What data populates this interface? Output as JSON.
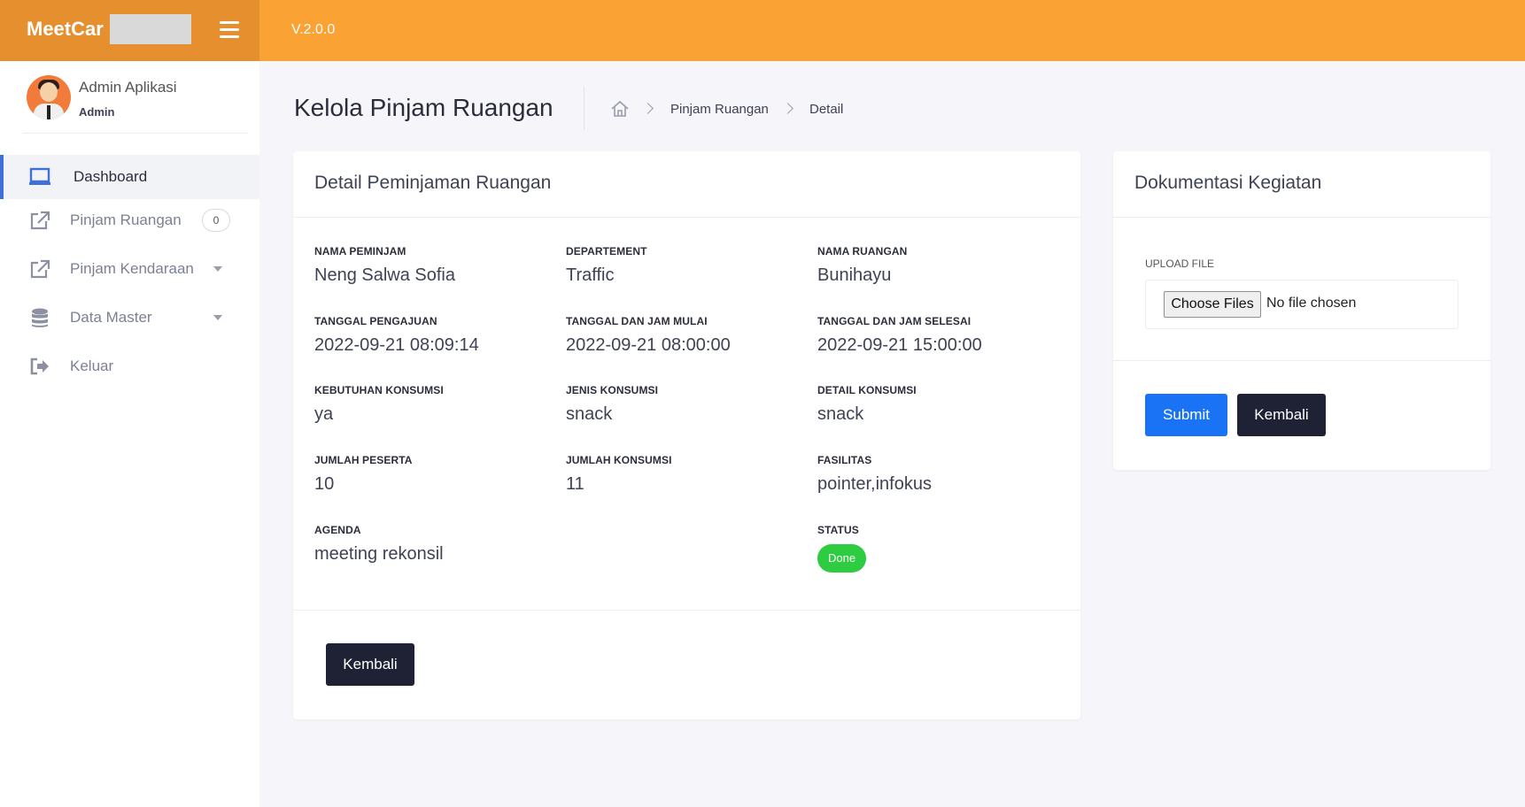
{
  "topbar": {
    "brand": "MeetCar",
    "version": "V.2.0.0"
  },
  "user": {
    "name": "Admin Aplikasi",
    "role": "Admin"
  },
  "sidebar": {
    "items": [
      {
        "label": "Dashboard",
        "icon": "laptop-icon",
        "active": true
      },
      {
        "label": "Pinjam Ruangan",
        "icon": "external-link-icon",
        "badge": "0"
      },
      {
        "label": "Pinjam Kendaraan",
        "icon": "external-link-icon",
        "has_caret": true
      },
      {
        "label": "Data Master",
        "icon": "database-icon",
        "has_caret": true
      },
      {
        "label": "Keluar",
        "icon": "sign-out-icon"
      }
    ]
  },
  "header": {
    "title": "Kelola Pinjam Ruangan",
    "breadcrumb": [
      "Pinjam Ruangan",
      "Detail"
    ]
  },
  "detail": {
    "title": "Detail Peminjaman Ruangan",
    "fields": {
      "nama_peminjam": {
        "label": "NAMA PEMINJAM",
        "value": "Neng Salwa Sofia"
      },
      "departement": {
        "label": "DEPARTEMENT",
        "value": "Traffic"
      },
      "nama_ruangan": {
        "label": "NAMA RUANGAN",
        "value": "Bunihayu"
      },
      "tanggal_pengajuan": {
        "label": "TANGGAL PENGAJUAN",
        "value": "2022-09-21 08:09:14"
      },
      "tanggal_mulai": {
        "label": "TANGGAL DAN JAM MULAI",
        "value": "2022-09-21 08:00:00"
      },
      "tanggal_selesai": {
        "label": "TANGGAL DAN JAM SELESAI",
        "value": "2022-09-21 15:00:00"
      },
      "kebutuhan_konsumsi": {
        "label": "KEBUTUHAN KONSUMSI",
        "value": "ya"
      },
      "jenis_konsumsi": {
        "label": "JENIS KONSUMSI",
        "value": "snack"
      },
      "detail_konsumsi": {
        "label": "DETAIL KONSUMSI",
        "value": "snack"
      },
      "jumlah_peserta": {
        "label": "JUMLAH PESERTA",
        "value": "10"
      },
      "jumlah_konsumsi": {
        "label": "JUMLAH KONSUMSI",
        "value": "11"
      },
      "fasilitas": {
        "label": "FASILITAS",
        "value": "pointer,infokus"
      },
      "agenda": {
        "label": "AGENDA",
        "value": "meeting rekonsil"
      },
      "status": {
        "label": "STATUS",
        "value": "Done"
      }
    },
    "back_label": "Kembali"
  },
  "documentation": {
    "title": "Dokumentasi Kegiatan",
    "upload_label": "UPLOAD FILE",
    "choose_label": "Choose Files",
    "no_file_text": "No file chosen",
    "submit_label": "Submit",
    "back_label": "Kembali"
  },
  "colors": {
    "topbar": "#fba234",
    "brand_bg": "#e58f2e",
    "primary": "#1a73f5",
    "dark_button": "#1f2235",
    "status_done": "#2ecc40",
    "active_indicator": "#3f6fd8"
  }
}
